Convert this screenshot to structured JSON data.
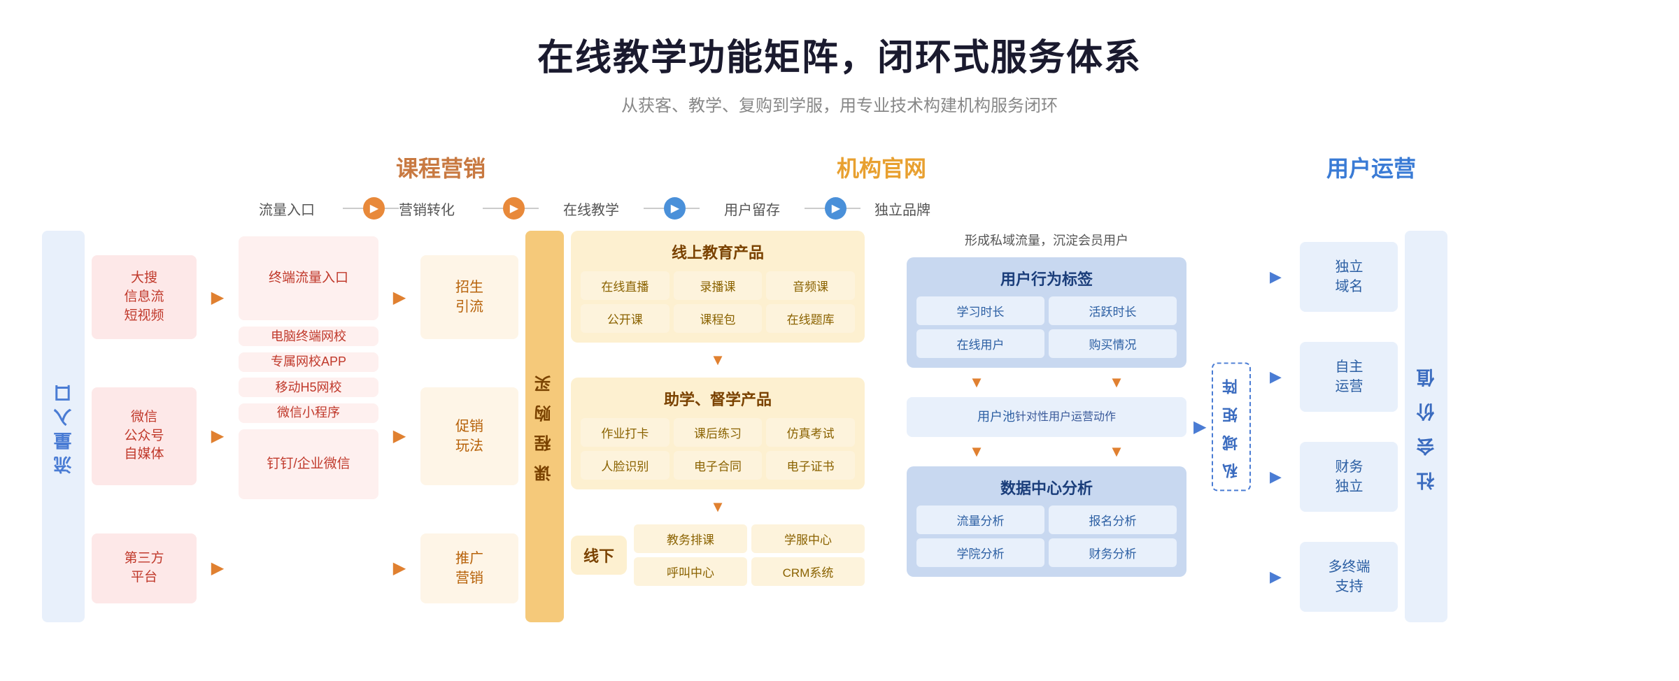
{
  "page": {
    "title": "在线教学功能矩阵，闭环式服务体系",
    "subtitle": "从获客、教学、复购到学服，用专业技术构建机构服务闭环"
  },
  "categories": {
    "marketing": "课程营销",
    "website": "机构官网",
    "user": "用户运营"
  },
  "flow_stages": {
    "traffic": "流量入口",
    "conversion": "营销转化",
    "online_teaching": "在线教学",
    "user_retention": "用户留存",
    "brand": "独立品牌"
  },
  "left_label": "流量入口",
  "traffic_sources": [
    {
      "label": "大搜\n信息流\n短视频"
    },
    {
      "label": "微信\n公众号\n自媒体"
    },
    {
      "label": "第三方\n平台"
    }
  ],
  "terminal_flow": {
    "label": "终端流量入口"
  },
  "platforms": [
    "电脑终端网校",
    "专属网校APP",
    "移动H5网校",
    "微信小程序"
  ],
  "third_party": "钉钉/企业微信",
  "conversion_methods": {
    "recruit": "招生\n引流",
    "promo": "促销\n玩法",
    "marketing": "推广\n营销"
  },
  "course_purchase": "课\n程\n购\n买",
  "online_education": {
    "header": "线上教育产品",
    "items": [
      "在线直播",
      "录播课",
      "音频课",
      "公开课",
      "课程包",
      "在线题库"
    ]
  },
  "study_products": {
    "header": "助学、督学产品",
    "items": [
      "作业打卡",
      "课后练习",
      "仿真考试",
      "人脸识别",
      "电子合同",
      "电子证书"
    ]
  },
  "offline": {
    "header": "线下",
    "items": [
      "教务排课",
      "学服中心",
      "呼叫中心",
      "CRM系统"
    ]
  },
  "user_retention": {
    "intro": "形成私域流量，沉淀会员用户",
    "behavior_tag": "用户行为标签",
    "tags": [
      "学习时长",
      "活跃时长",
      "在线用户",
      "购买情况"
    ],
    "user_pool": "用户池\n针对性用户运营动作",
    "data_analysis": "数据中心分析",
    "analysis_items": [
      "流量分析",
      "报名分析",
      "学院分析",
      "财务分析"
    ]
  },
  "private_matrix": "私\n域\n矩\n阵",
  "brand_items": [
    "独立\n域名",
    "自主\n运营",
    "财务\n独立",
    "多终端\n支持"
  ],
  "social_value": "社\n会\n价\n值"
}
